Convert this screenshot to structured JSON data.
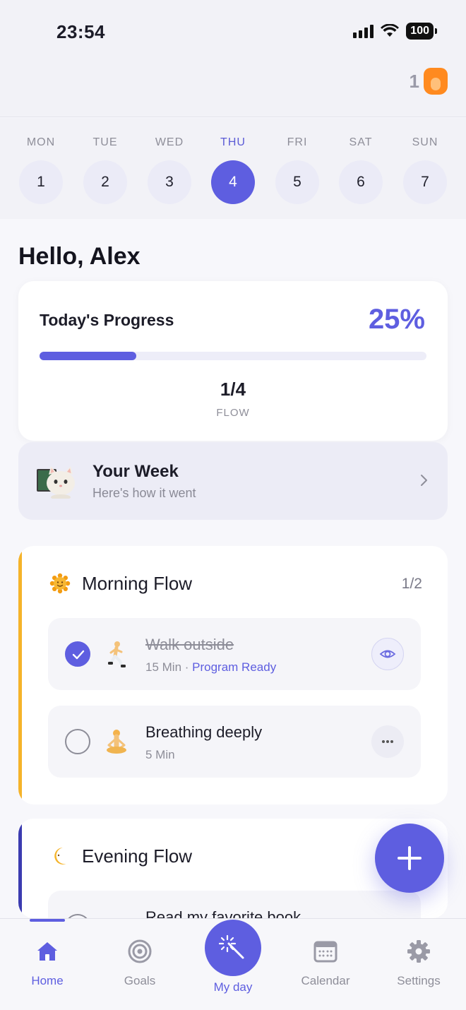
{
  "status_bar": {
    "time": "23:54",
    "battery": "100"
  },
  "header": {
    "streak_count": "1"
  },
  "week": {
    "days": [
      {
        "label": "MON",
        "num": "1"
      },
      {
        "label": "TUE",
        "num": "2"
      },
      {
        "label": "WED",
        "num": "3"
      },
      {
        "label": "THU",
        "num": "4"
      },
      {
        "label": "FRI",
        "num": "5"
      },
      {
        "label": "SAT",
        "num": "6"
      },
      {
        "label": "SUN",
        "num": "7"
      }
    ],
    "selected": "THU"
  },
  "greeting": "Hello, Alex",
  "progress": {
    "title": "Today's Progress",
    "percent_label": "25%",
    "percent": 0.25,
    "fraction": "1/4",
    "sublabel": "FLOW"
  },
  "your_week": {
    "title": "Your Week",
    "subtitle": "Here's how it went"
  },
  "morning_flow": {
    "title": "Morning Flow",
    "count": "1/2",
    "tasks": [
      {
        "title": "Walk outside",
        "duration": "15 Min",
        "separator": " · ",
        "status": "Program Ready",
        "done": true
      },
      {
        "title": "Breathing deeply",
        "duration": "5 Min",
        "done": false
      }
    ]
  },
  "evening_flow": {
    "title": "Evening Flow",
    "tasks": [
      {
        "title": "Read my favorite book"
      }
    ]
  },
  "tabs": {
    "home": "Home",
    "goals": "Goals",
    "myday": "My day",
    "calendar": "Calendar",
    "settings": "Settings"
  },
  "colors": {
    "accent": "#5e5ee0",
    "morning": "#f5b32a",
    "evening": "#3b3bb0"
  }
}
